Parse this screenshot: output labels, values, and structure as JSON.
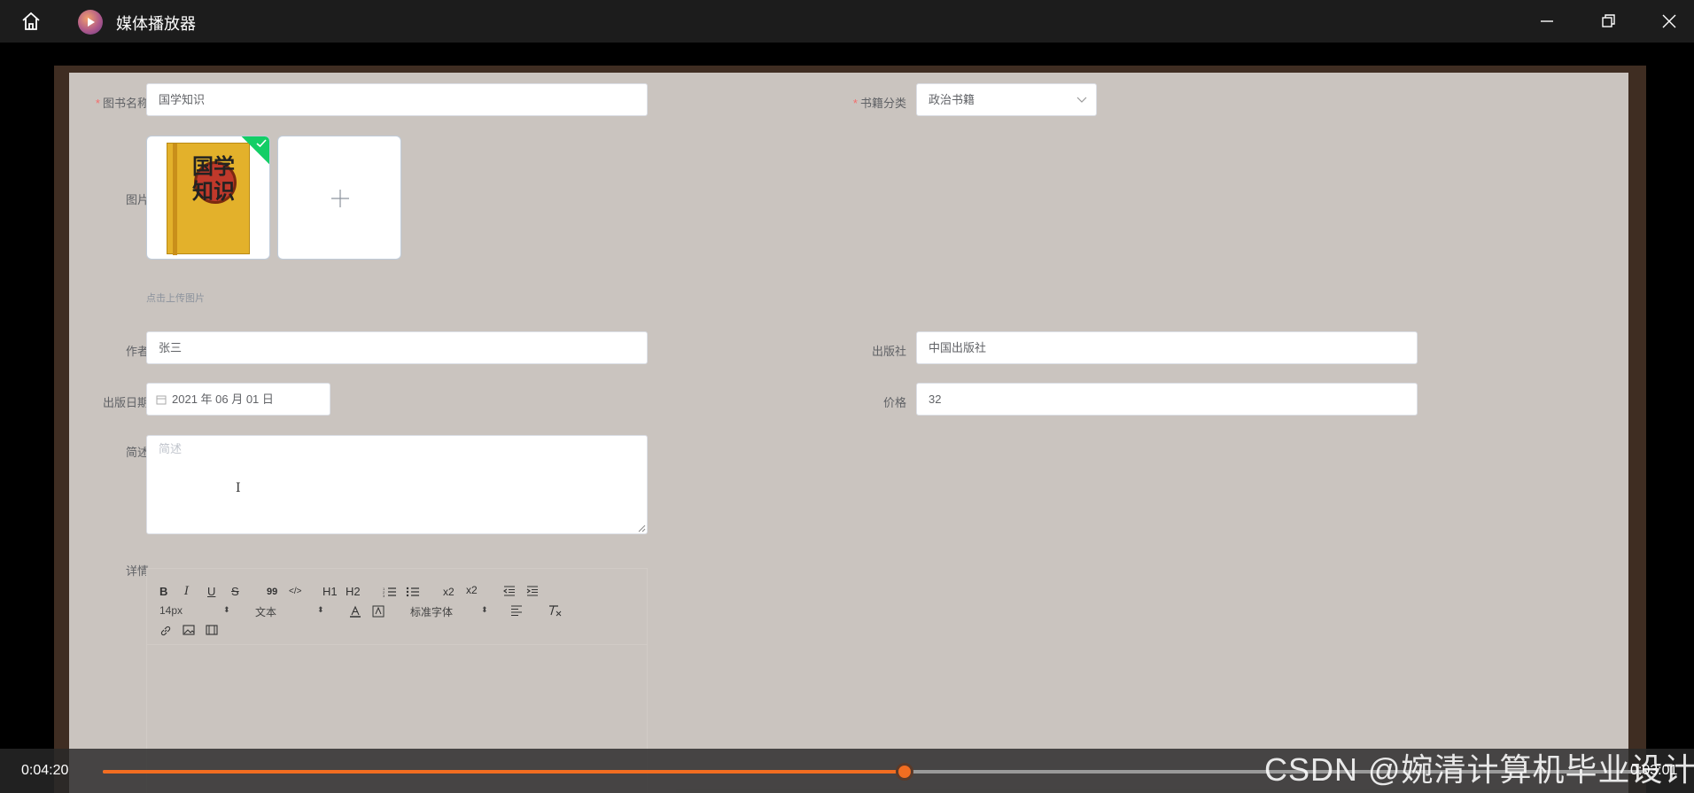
{
  "window": {
    "title": "媒体播放器"
  },
  "form": {
    "book_name": {
      "label": "图书名称",
      "value": "国学知识"
    },
    "category": {
      "label": "书籍分类",
      "value": "政治书籍"
    },
    "image": {
      "label": "图片",
      "upload_tip": "点击上传图片",
      "cover_text": "国学知识"
    },
    "author": {
      "label": "作者",
      "value": "张三"
    },
    "publisher": {
      "label": "出版社",
      "value": "中国出版社"
    },
    "pub_date": {
      "label": "出版日期",
      "value": "2021 年 06 月 01 日"
    },
    "price": {
      "label": "价格",
      "value": "32"
    },
    "summary": {
      "label": "简述",
      "placeholder": "简述"
    },
    "details": {
      "label": "详情",
      "toolbar": {
        "bold": "B",
        "italic": "I",
        "underline": "U",
        "strike": "S",
        "blockquote": "99",
        "code": "</>",
        "h1": "H1",
        "h2": "H2",
        "sub": "x2",
        "sup": "x2",
        "size_select": "14px",
        "text_select": "文本",
        "font_select": "标准字体"
      }
    }
  },
  "player": {
    "current_time": "0:04:20",
    "total_time": "0:03:01",
    "progress": 0.52,
    "watermark": "CSDN @婉清计算机毕业设计"
  },
  "colors": {
    "accent": "#f26d21",
    "required": "#f56c6c"
  }
}
